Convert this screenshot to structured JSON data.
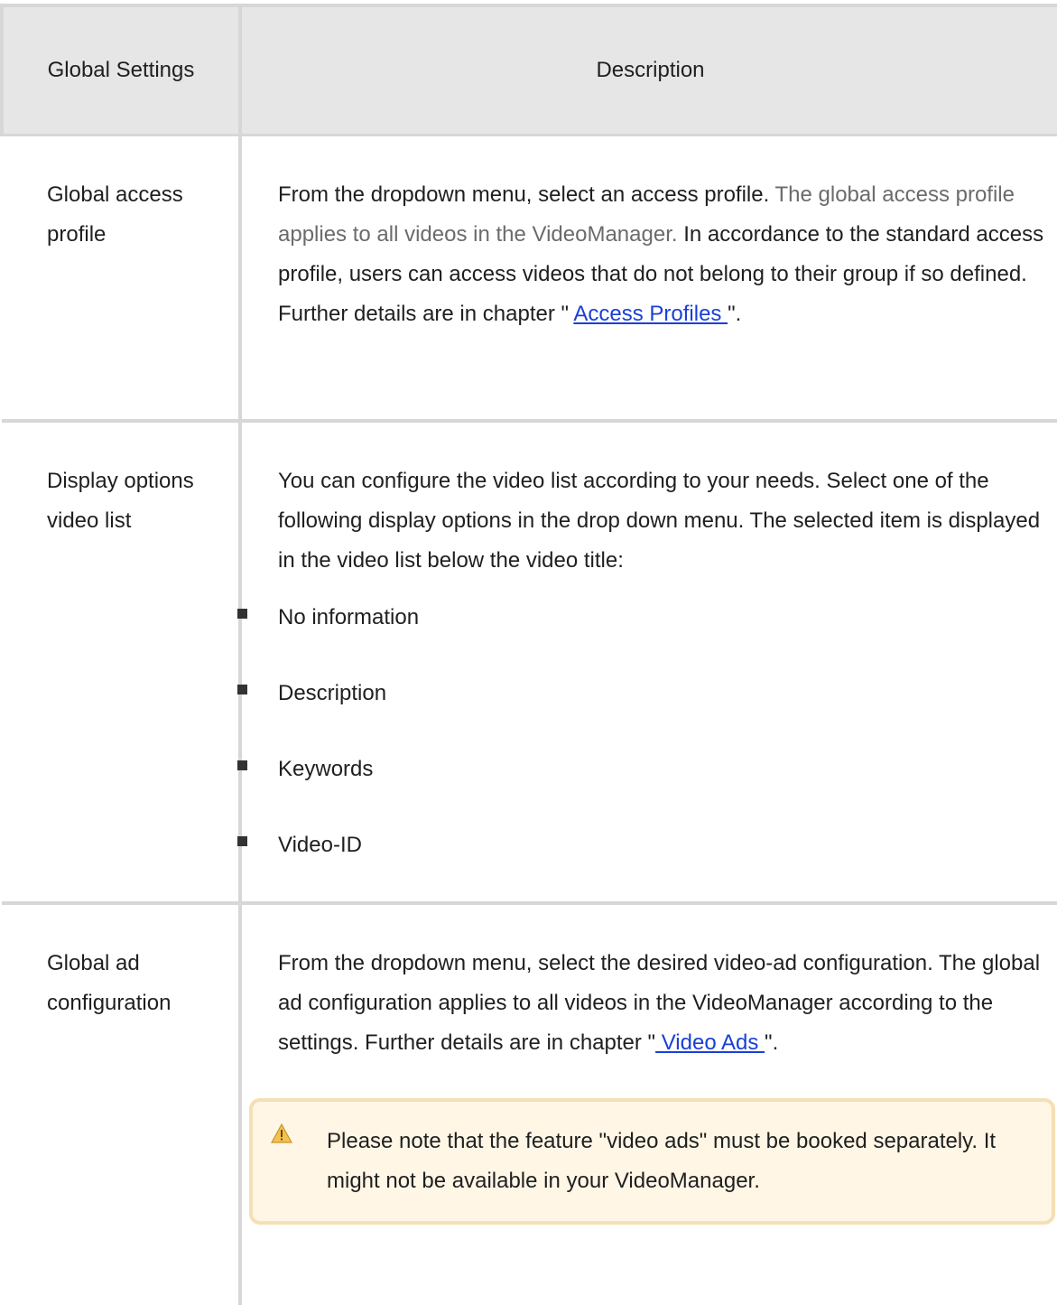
{
  "table": {
    "headers": {
      "col1": "Global Settings",
      "col2": "Description"
    },
    "rows": [
      {
        "name": "Global access profile",
        "desc_part1": "From the dropdown menu, select an access profile. ",
        "desc_muted": "The global access profile applies to all videos in the VideoManager.",
        "desc_part2": " In accordance to the standard access profile, users can access videos that do not belong to their group if so defined. Further details are in chapter \" ",
        "link": "Access Profiles ",
        "desc_end": "\"."
      },
      {
        "name": "Display options video list",
        "desc": "You can configure the video list according to your needs. Select one of the following display options in the drop down menu. The selected item is displayed in the video list below the video title:",
        "options": [
          "No information",
          "Description",
          "Keywords",
          "Video-ID"
        ]
      },
      {
        "name": "Global ad configuration",
        "desc_part1": "From the dropdown menu, select the desired video-ad configuration. The global ad configuration applies to all videos in the VideoManager according to the settings. Further details are in chapter \"",
        "link": " Video Ads ",
        "desc_end": "\".",
        "note": "Please note that the feature \"video ads\" must be booked separately. It might not be available in your VideoManager."
      }
    ]
  },
  "colors": {
    "header_bg": "#e6e6e6",
    "border": "#d7d7d7",
    "link": "#1a3fd6",
    "note_bg": "#fff6e6",
    "note_border": "#f5dfb4",
    "warning_icon": "#f2c14e"
  }
}
